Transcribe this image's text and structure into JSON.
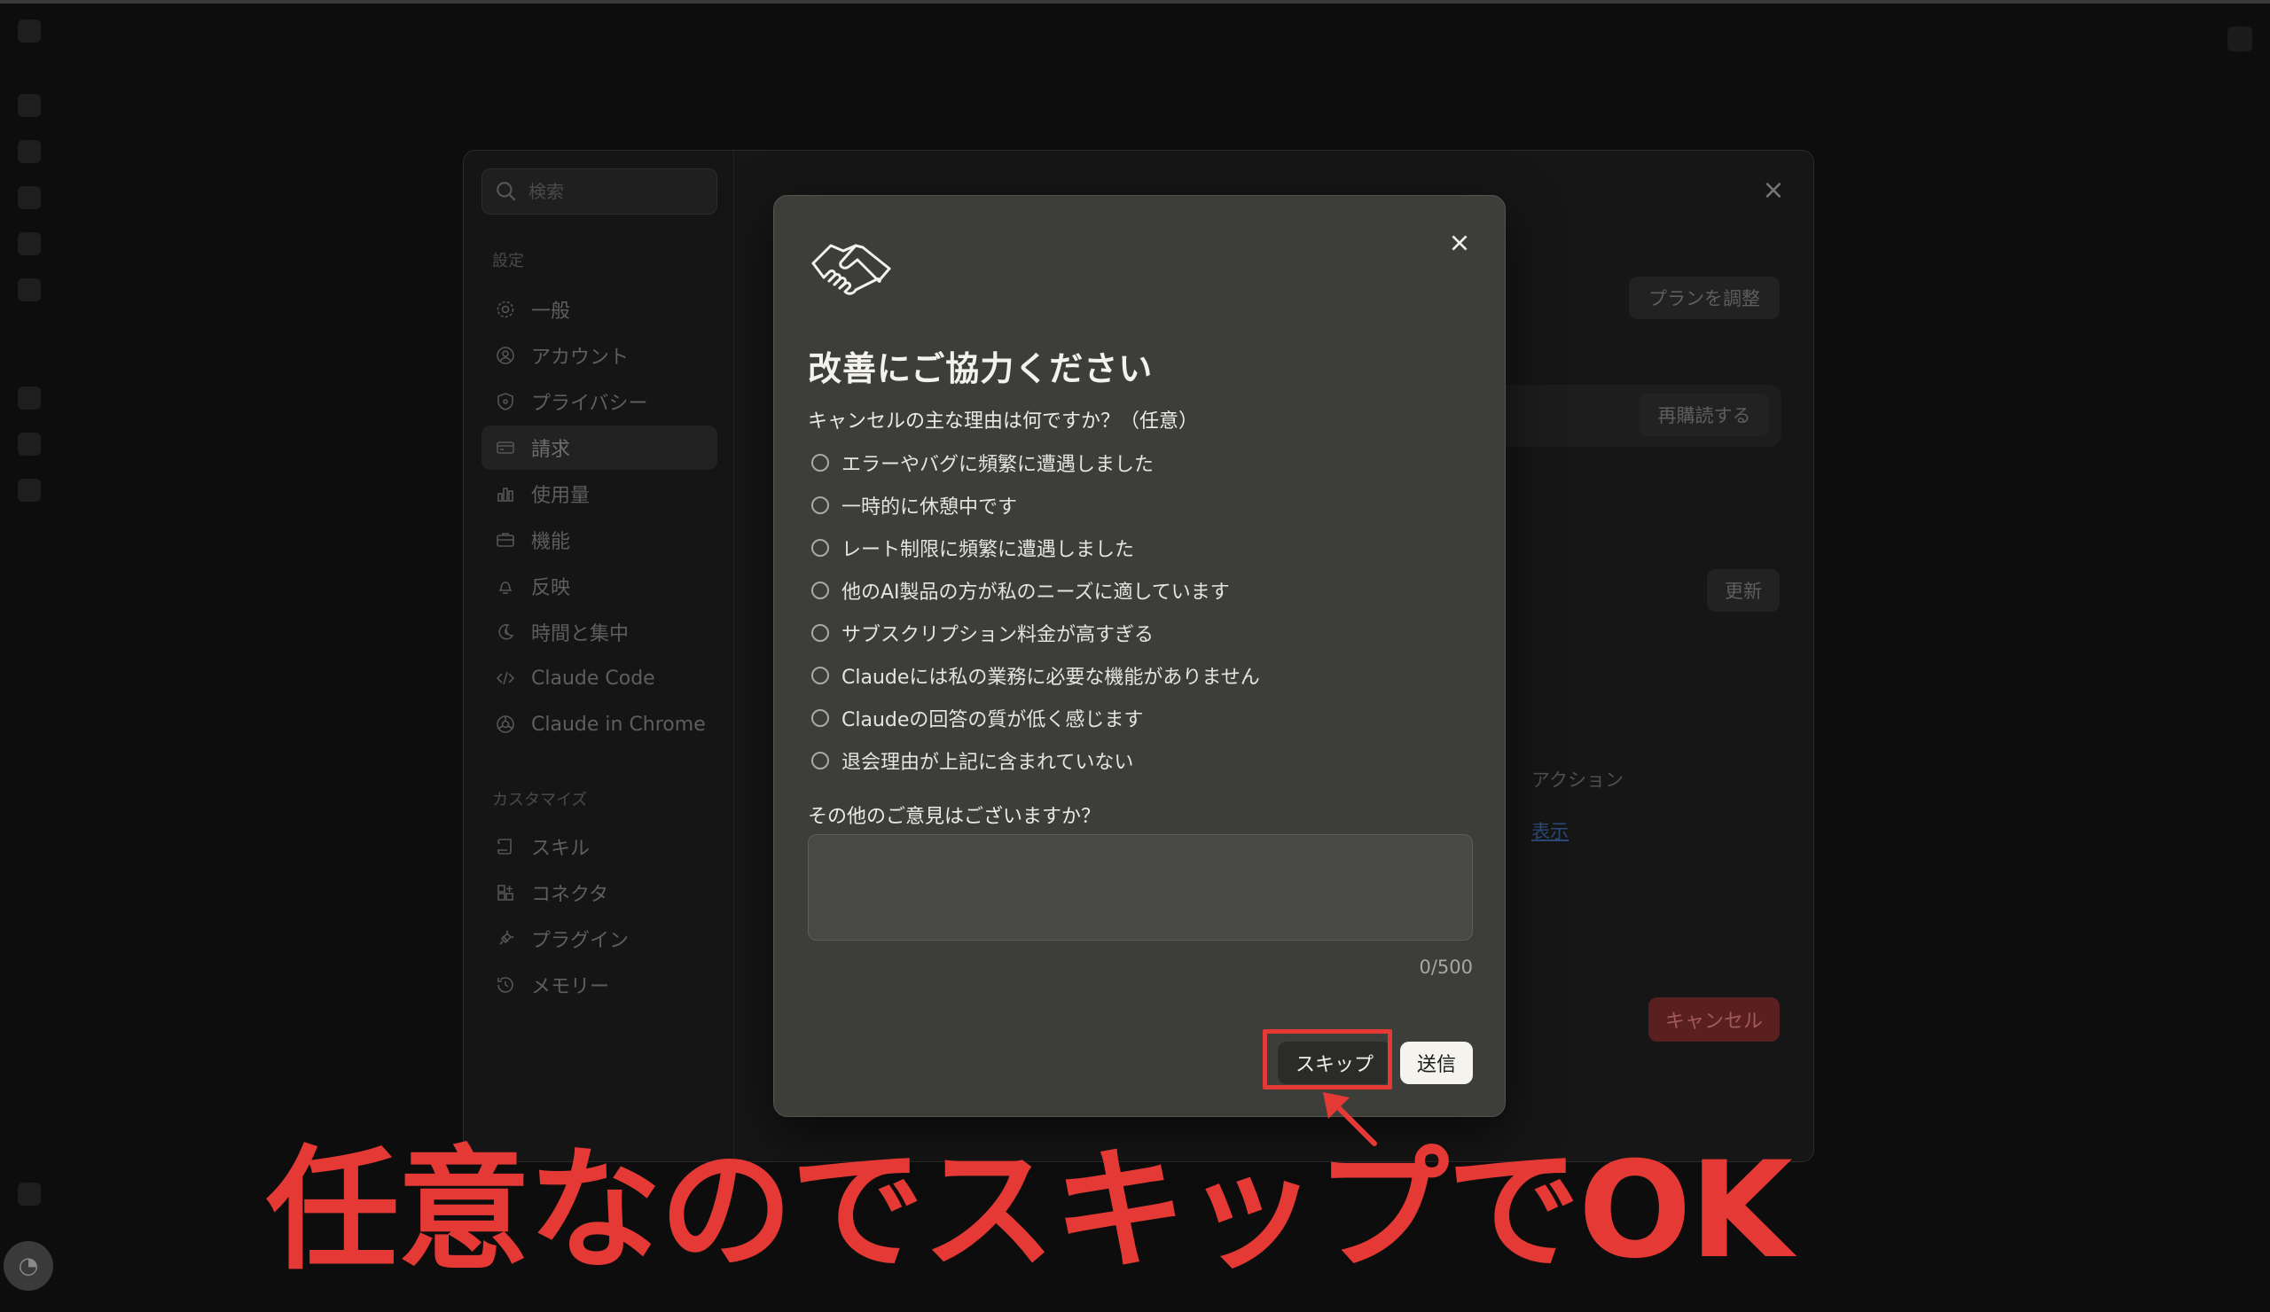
{
  "settings": {
    "search_placeholder": "検索",
    "section_settings": "設定",
    "section_customize": "カスタマイズ",
    "nav": [
      {
        "label": "一般",
        "icon": "gear-icon"
      },
      {
        "label": "アカウント",
        "icon": "user-circle-icon"
      },
      {
        "label": "プライバシー",
        "icon": "shield-icon"
      },
      {
        "label": "請求",
        "icon": "credit-card-icon",
        "active": true
      },
      {
        "label": "使用量",
        "icon": "bar-chart-icon"
      },
      {
        "label": "機能",
        "icon": "briefcase-icon"
      },
      {
        "label": "反映",
        "icon": "bell-icon"
      },
      {
        "label": "時間と集中",
        "icon": "moon-icon"
      },
      {
        "label": "Claude Code",
        "icon": "code-icon"
      },
      {
        "label": "Claude in Chrome",
        "icon": "globe-icon"
      }
    ],
    "customize_nav": [
      {
        "label": "スキル",
        "icon": "scroll-icon"
      },
      {
        "label": "コネクタ",
        "icon": "grid-plus-icon"
      },
      {
        "label": "プラグイン",
        "icon": "plug-icon"
      },
      {
        "label": "メモリー",
        "icon": "history-icon"
      }
    ],
    "adjust_plan_label": "プランを調整",
    "resubscribe_label": "再購読する",
    "update_label": "更新",
    "action_header": "アクション",
    "view_link": "表示",
    "cancel_label": "キャンセル"
  },
  "modal": {
    "title": "改善にご協力ください",
    "question": "キャンセルの主な理由は何ですか？（任意）",
    "options": [
      "エラーやバグに頻繁に遭遇しました",
      "一時的に休憩中です",
      "レート制限に頻繁に遭遇しました",
      "他のAI製品の方が私のニーズに適しています",
      "サブスクリプション料金が高すぎる",
      "Claudeには私の業務に必要な機能がありません",
      "Claudeの回答の質が低く感じます",
      "退会理由が上記に含まれていない"
    ],
    "other_label": "その他のご意見はございますか？",
    "textarea_value": "",
    "counter": "0/500",
    "skip_label": "スキップ",
    "send_label": "送信"
  },
  "annotation": {
    "text": "任意なのでスキップでOK",
    "color": "#e53935"
  }
}
